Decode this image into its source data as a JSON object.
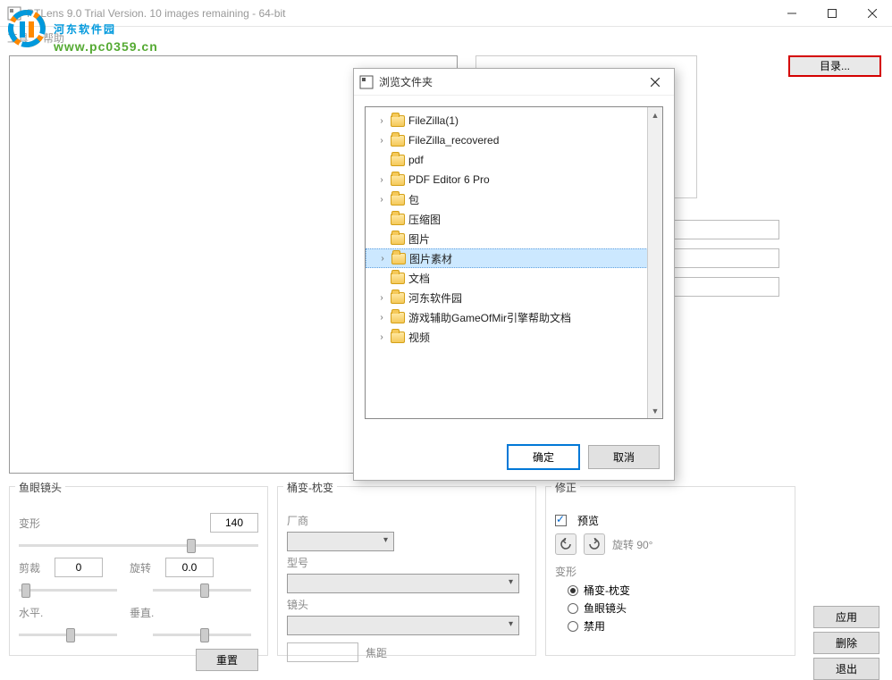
{
  "window": {
    "title": "PTLens 9.0 Trial Version. 10 images remaining - 64-bit"
  },
  "menu": {
    "tools": "工具",
    "help": "帮助"
  },
  "watermark": {
    "text_cn": "河东软件园",
    "url": "www.pc0359.cn"
  },
  "directory_button": "目录...",
  "dialog": {
    "title": "浏览文件夹",
    "ok": "确定",
    "cancel": "取消",
    "items": [
      {
        "label": "FileZilla(1)",
        "expander": "›"
      },
      {
        "label": "FileZilla_recovered",
        "expander": "›"
      },
      {
        "label": "pdf",
        "expander": " "
      },
      {
        "label": "PDF Editor 6 Pro",
        "expander": "›"
      },
      {
        "label": "包",
        "expander": "›"
      },
      {
        "label": "压缩图",
        "expander": " "
      },
      {
        "label": "图片",
        "expander": " "
      },
      {
        "label": "图片素材",
        "expander": "›",
        "selected": true
      },
      {
        "label": "文档",
        "expander": " "
      },
      {
        "label": "河东软件园",
        "expander": "›"
      },
      {
        "label": "游戏辅助GameOfMir引擎帮助文档",
        "expander": "›"
      },
      {
        "label": "视频",
        "expander": "›"
      }
    ]
  },
  "fisheye": {
    "title": "鱼眼镜头",
    "deform": "变形",
    "deform_value": "140",
    "crop": "剪裁",
    "crop_value": "0",
    "rotate": "旋转",
    "rotate_value": "0.0",
    "horiz": "水平.",
    "vert": "垂直.",
    "reset": "重置"
  },
  "barrel": {
    "title": "桶变-枕变",
    "vendor": "厂商",
    "model": "型号",
    "lens": "镜头",
    "focal": "焦距"
  },
  "correct": {
    "title": "修正",
    "preview": "预览",
    "preview_checked": true,
    "rotate_label": "旋转 90°",
    "deform": "变形",
    "opt_barrel": "桶变-枕变",
    "opt_fisheye": "鱼眼镜头",
    "opt_disable": "禁用"
  },
  "actions": {
    "apply": "应用",
    "delete": "删除",
    "exit": "退出"
  }
}
